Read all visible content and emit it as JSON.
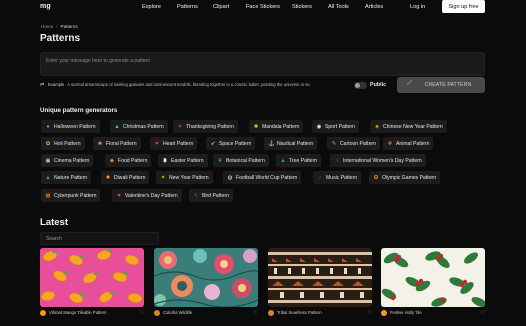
{
  "logo": "mg",
  "nav": {
    "explore": "Explore",
    "patterns": "Patterns",
    "clipart": "Clipart",
    "face_stickers": "Face Stickers",
    "stickers": "Stickers",
    "all_tools": "All Tools",
    "articles": "Articles",
    "login": "Log in",
    "signup": "Sign up free"
  },
  "breadcrumb": {
    "home": "Home",
    "separator": "/",
    "current": "Patterns"
  },
  "page_title": "Patterns",
  "prompt": {
    "placeholder": "Enter your message here to generate a pattern"
  },
  "example": {
    "label": "Example",
    "text": "A surreal dreamscape of swirling galaxies and luminescent tendrils, blending together in a cosmic ballet, painting the universe in vic"
  },
  "public_label": "Public",
  "create_button": "CREATE PATTERN",
  "generators": {
    "heading": "Unique pattern generators",
    "items": [
      {
        "label": "Halloween Pattern",
        "icon": "pumpkin-icon",
        "color": "#e67e22"
      },
      {
        "label": "Christmas Pattern",
        "icon": "tree-icon",
        "color": "#2ecc71"
      },
      {
        "label": "Thanksgiving Pattern",
        "icon": "turkey-icon",
        "color": "#d35400"
      },
      {
        "label": "Mandala Pattern",
        "icon": "mandala-icon",
        "color": "#f1c40f"
      },
      {
        "label": "Sport Pattern",
        "icon": "ball-icon",
        "color": "#ecf0f1"
      },
      {
        "label": "Chinese New Year Pattern",
        "icon": "lantern-icon",
        "color": "#f39c12"
      },
      {
        "label": "Holi Pattern",
        "icon": "paint-icon",
        "color": "#f1c40f"
      },
      {
        "label": "Floral Pattern",
        "icon": "flower-icon",
        "color": "#ff7fbf"
      },
      {
        "label": "Heart Pattern",
        "icon": "heart-icon",
        "color": "#e74c3c"
      },
      {
        "label": "Space Pattern",
        "icon": "rocket-icon",
        "color": "#ecf0f1"
      },
      {
        "label": "Nautical Pattern",
        "icon": "anchor-icon",
        "color": "#3498db"
      },
      {
        "label": "Cartoon Pattern",
        "icon": "pencil-icon",
        "color": "#f39c12"
      },
      {
        "label": "Animal Pattern",
        "icon": "paw-icon",
        "color": "#e67e22"
      },
      {
        "label": "Cinema Pattern",
        "icon": "film-icon",
        "color": "#bdc3c7"
      },
      {
        "label": "Food Pattern",
        "icon": "food-icon",
        "color": "#e67e22"
      },
      {
        "label": "Easter Pattern",
        "icon": "egg-icon",
        "color": "#ecf0f1"
      },
      {
        "label": "Botanical Pattern",
        "icon": "leaf-icon",
        "color": "#27ae60"
      },
      {
        "label": "Tree Pattern",
        "icon": "pine-icon",
        "color": "#27ae60"
      },
      {
        "label": "International Women's Day Pattern",
        "icon": "women-icon",
        "color": "#e74c3c"
      },
      {
        "label": "Nature Pattern",
        "icon": "mountain-icon",
        "color": "#27ae60"
      },
      {
        "label": "Diwali Pattern",
        "icon": "lamp-icon",
        "color": "#f39c12"
      },
      {
        "label": "New Year Pattern",
        "icon": "confetti-icon",
        "color": "#f1c40f"
      },
      {
        "label": "Football World Cup Pattern",
        "icon": "football-icon",
        "color": "#ecf0f1"
      },
      {
        "label": "Music Pattern",
        "icon": "music-icon",
        "color": "#8e44ad"
      },
      {
        "label": "Olympic Games Pattern",
        "icon": "medal-icon",
        "color": "#f39c12"
      },
      {
        "label": "Cyberpunk Pattern",
        "icon": "chip-icon",
        "color": "#e67e22"
      },
      {
        "label": "Valentine's Day Pattern",
        "icon": "valentine-icon",
        "color": "#e74c3c"
      },
      {
        "label": "Bird Pattern",
        "icon": "bird-icon",
        "color": "#e74c3c"
      }
    ]
  },
  "latest": {
    "heading": "Latest",
    "search_placeholder": "Search",
    "cards": [
      {
        "caption": "Vibrant Mango Tileable Pattern",
        "avatar_color": "#f39c12"
      },
      {
        "caption": "Colorful Wildlife",
        "avatar_color": "#e67e22"
      },
      {
        "caption": "Tribal Seamless Pattern",
        "avatar_color": "#e67e22"
      },
      {
        "caption": "Festive Holly Tile",
        "avatar_color": "#f39c12"
      }
    ]
  }
}
